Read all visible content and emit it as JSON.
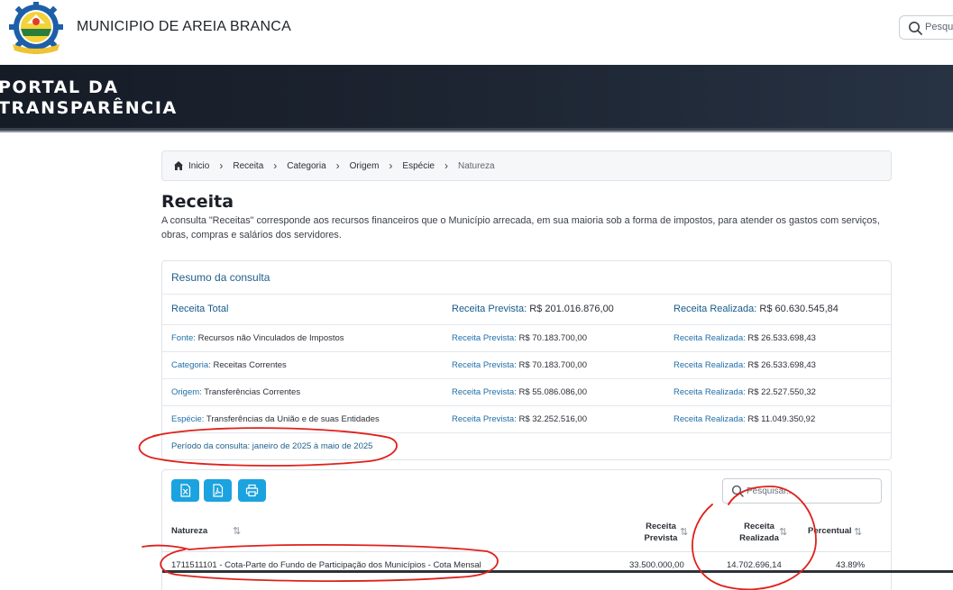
{
  "header": {
    "site_name": "MUNICIPIO DE AREIA BRANCA",
    "logo_text": "AREIA BRANCA",
    "search_placeholder": "Pesquisar"
  },
  "banner": {
    "title_line1": "PORTAL DA",
    "title_line2": "TRANSPARÊNCIA"
  },
  "breadcrumb": {
    "items": [
      "Inicio",
      "Receita",
      "Categoria",
      "Origem",
      "Espécie",
      "Natureza"
    ]
  },
  "page": {
    "title": "Receita",
    "description": "A consulta \"Receitas\" corresponde aos recursos financeiros que o Município arrecada, em sua maioria sob a forma de impostos, para atender os gastos com serviços, obras, compras e salários dos servidores."
  },
  "summary": {
    "title": "Resumo da consulta",
    "total": {
      "label": "Receita Total",
      "prevista_label": "Receita Prevista:",
      "prevista_value": "R$ 201.016.876,00",
      "realizada_label": "Receita Realizada:",
      "realizada_value": "R$ 60.630.545,84"
    },
    "rows": [
      {
        "key": "Fonte:",
        "value": "Recursos não Vinculados de Impostos",
        "prevista_label": "Receita Prevista:",
        "prevista_value": "R$ 70.183.700,00",
        "realizada_label": "Receita Realizada:",
        "realizada_value": "R$ 26.533.698,43"
      },
      {
        "key": "Categoria:",
        "value": "Receitas Correntes",
        "prevista_label": "Receita Prevista:",
        "prevista_value": "R$ 70.183.700,00",
        "realizada_label": "Receita Realizada:",
        "realizada_value": "R$ 26.533.698,43"
      },
      {
        "key": "Origem:",
        "value": "Transferências Correntes",
        "prevista_label": "Receita Prevista:",
        "prevista_value": "R$ 55.086.086,00",
        "realizada_label": "Receita Realizada:",
        "realizada_value": "R$ 22.527.550,32"
      },
      {
        "key": "Espécie:",
        "value": "Transferências da União e de suas Entidades",
        "prevista_label": "Receita Prevista:",
        "prevista_value": "R$ 32.252.516,00",
        "realizada_label": "Receita Realizada:",
        "realizada_value": "R$ 11.049.350,92"
      }
    ],
    "periodo_label": "Período da consulta:",
    "periodo_value": "janeiro de 2025 à maio de 2025"
  },
  "table": {
    "search_placeholder": "Pesquisar...",
    "buttons": [
      "excel-icon",
      "pdf-icon",
      "print-icon"
    ],
    "columns": {
      "natureza": "Natureza",
      "prevista_l1": "Receita",
      "prevista_l2": "Prevista",
      "realizada_l1": "Receita",
      "realizada_l2": "Realizada",
      "percentual": "Percentual"
    },
    "rows": [
      {
        "natureza": "1711511101 - Cota-Parte do Fundo de Participação dos Municípios - Cota Mensal",
        "prevista": "33.500.000,00",
        "realizada": "14.702.696,14",
        "percentual": "43.89%"
      }
    ]
  },
  "colors": {
    "accent": "#1ba3df",
    "link": "#1f6ea8",
    "banner": "#1d2532",
    "annotation": "#e0201b"
  }
}
